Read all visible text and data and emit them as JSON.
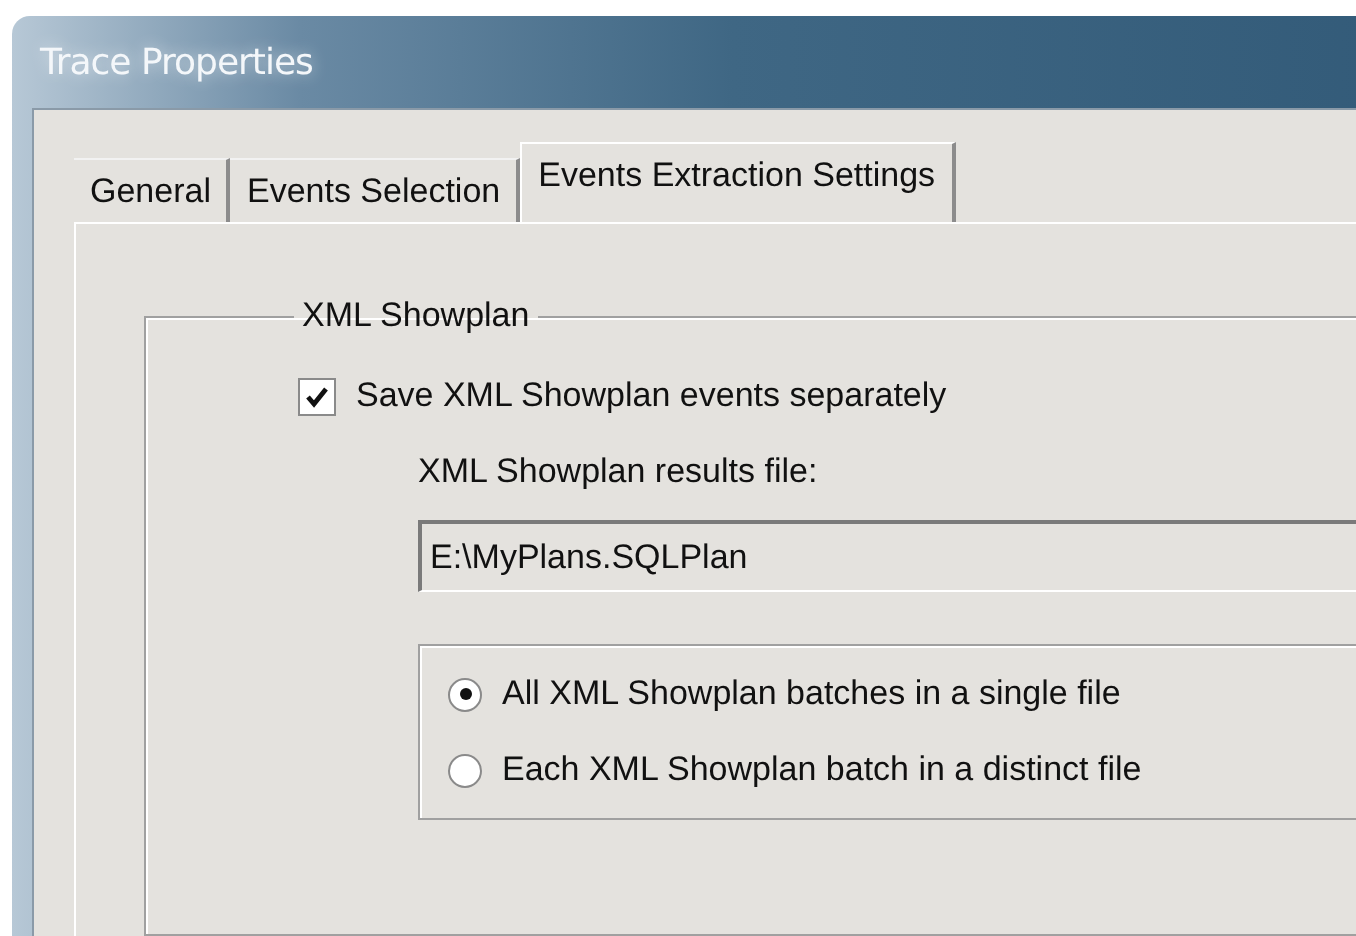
{
  "window": {
    "title": "Trace Properties"
  },
  "tabs": [
    {
      "label": "General",
      "selected": false
    },
    {
      "label": "Events Selection",
      "selected": false
    },
    {
      "label": "Events Extraction Settings",
      "selected": true
    }
  ],
  "group": {
    "title": "XML Showplan",
    "save_separately": {
      "label": "Save XML Showplan events separately",
      "checked": true
    },
    "results_file": {
      "label": "XML Showplan results file:",
      "value": "E:\\MyPlans.SQLPlan"
    },
    "options": [
      {
        "label": "All XML Showplan batches in a single file",
        "selected": true
      },
      {
        "label": "Each XML Showplan batch in a distinct file",
        "selected": false
      }
    ]
  }
}
